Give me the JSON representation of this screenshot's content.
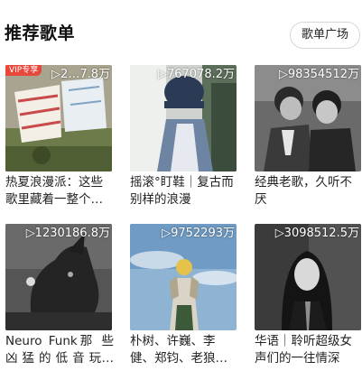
{
  "section": {
    "title": "推荐歌单",
    "more_label": "歌单广场"
  },
  "playlists": [
    {
      "play_count": "▷2…7.8万",
      "title": "热夏浪漫派：这些歌里藏着一整个…",
      "badge": "VIP专享"
    },
    {
      "play_count": "▷767078.2万",
      "title": "摇滚°盯鞋｜复古而别样的浪漫"
    },
    {
      "play_count": "▷98354512万",
      "title": "经典老歌，久听不厌"
    },
    {
      "play_count": "▷1230186.8万",
      "title": "Neuro Funk那 些 凶 猛 的 低 音 玩…"
    },
    {
      "play_count": "▷9752293万",
      "title": "朴树、许巍、李健、郑钧、老狼…"
    },
    {
      "play_count": "▷3098512.5万",
      "title": "华语｜聆听超级女声们的一往情深"
    }
  ],
  "colors": {
    "badge": "#e8473c",
    "cover1": "#8a8f78",
    "cover2": "#6f8ea8",
    "cover3": "#4a4a4a",
    "cover4": "#3a3a3a",
    "cover5": "#7ea4c6",
    "cover6": "#2e2e2e"
  }
}
